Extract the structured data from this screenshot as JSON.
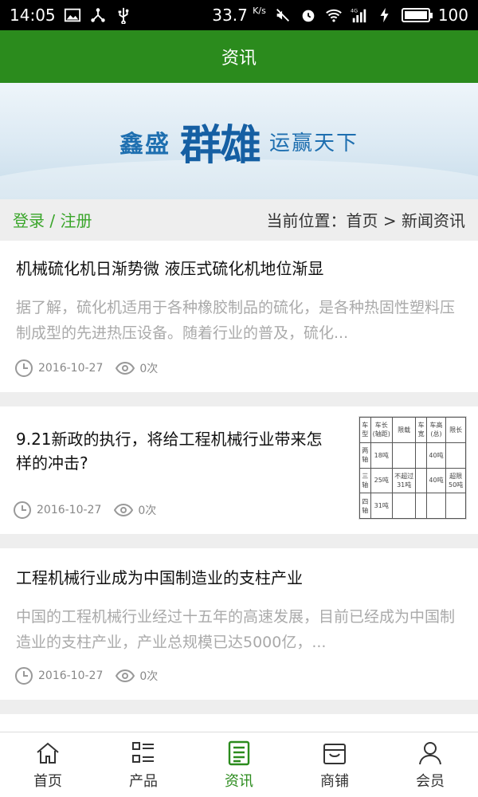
{
  "status_bar": {
    "time": "14:05",
    "speed_value": "33.7",
    "speed_unit": "K/s",
    "network": "4G",
    "battery": "100",
    "battery_level": 1.0,
    "icons": [
      "image-icon",
      "share-icon",
      "usb-icon",
      "mute-icon",
      "alarm-icon",
      "wifi-icon",
      "signal-icon",
      "charging-icon",
      "battery-icon"
    ]
  },
  "header": {
    "title": "资讯"
  },
  "banner": {
    "brand": "鑫盛",
    "highlight": "群雄",
    "tagline": "运赢天下"
  },
  "crumbs": {
    "login": "登录 / 注册",
    "location": "当前位置：首页 > 新闻资讯"
  },
  "articles": [
    {
      "title": "机械硫化机日渐势微 液压式硫化机地位渐显",
      "summary": "据了解，硫化机适用于各种橡胶制品的硫化，是各种热固性塑料压制成型的先进热压设备。随着行业的普及，硫化...",
      "date": "2016-10-27",
      "views": "0次"
    },
    {
      "title": "9.21新政的执行，将给工程机械行业带来怎样的冲击?",
      "date": "2016-10-27",
      "views": "0次",
      "thumb_table": [
        [
          "车型",
          "车长(轴距)",
          "限载",
          "车宽",
          "车高(总)",
          "限长"
        ],
        [
          "两轴",
          "18吨",
          "",
          "",
          "40吨",
          ""
        ],
        [
          "三轴",
          "25吨",
          "不超过31吨",
          "",
          "40吨",
          "超限50吨"
        ],
        [
          "四轴",
          "31吨",
          "",
          "",
          "",
          ""
        ]
      ]
    },
    {
      "title": "工程机械行业成为中国制造业的支柱产业",
      "summary": "中国的工程机械行业经过十五年的高速发展，目前已经成为中国制造业的支柱产业，产业总规模已达5000亿，...",
      "date": "2016-10-27",
      "views": "0次"
    }
  ],
  "bottom_nav": [
    {
      "label": "首页",
      "icon": "home-icon",
      "active": false
    },
    {
      "label": "产品",
      "icon": "list-icon",
      "active": false
    },
    {
      "label": "资讯",
      "icon": "news-icon",
      "active": true
    },
    {
      "label": "商铺",
      "icon": "store-icon",
      "active": false
    },
    {
      "label": "会员",
      "icon": "user-icon",
      "active": false
    }
  ],
  "colors": {
    "primary": "#2b8b1d",
    "login": "#3aa52a",
    "summary": "#aaaaaa"
  }
}
